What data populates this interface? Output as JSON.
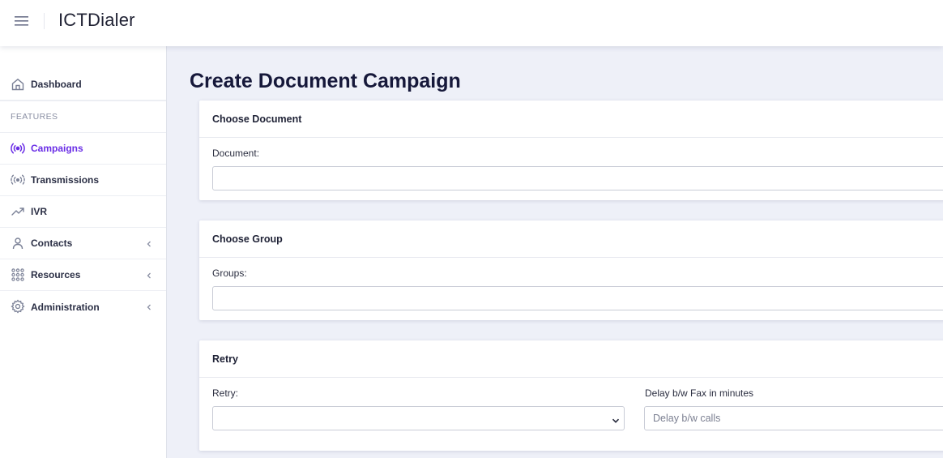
{
  "app": {
    "title": "ICTDialer"
  },
  "page": {
    "title": "Create Document Campaign"
  },
  "sidebar": {
    "section_features": "FEATURES",
    "items": [
      {
        "label": "Dashboard",
        "icon": "home-icon"
      },
      {
        "label": "Campaigns",
        "icon": "broadcast-icon",
        "active": true
      },
      {
        "label": "Transmissions",
        "icon": "signal-icon"
      },
      {
        "label": "IVR",
        "icon": "trending-up-icon"
      },
      {
        "label": "Contacts",
        "icon": "user-icon",
        "expandable": true
      },
      {
        "label": "Resources",
        "icon": "grid-icon",
        "expandable": true
      },
      {
        "label": "Administration",
        "icon": "gear-icon",
        "expandable": true
      }
    ]
  },
  "cards": {
    "document": {
      "title": "Choose Document",
      "label": "Document:",
      "value": ""
    },
    "group": {
      "title": "Choose Group",
      "label": "Groups:",
      "value": ""
    },
    "retry": {
      "title": "Retry",
      "retry_label": "Retry:",
      "retry_value": "",
      "delay_label": "Delay b/w Fax in minutes",
      "delay_placeholder": "Delay b/w calls"
    }
  },
  "colors": {
    "accent": "#6a2ee6",
    "background": "#eef0f8",
    "title": "#16183a"
  }
}
